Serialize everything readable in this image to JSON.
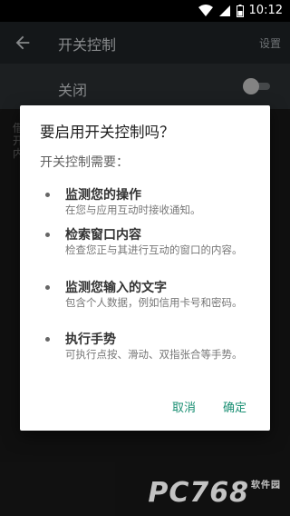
{
  "status_bar": {
    "time": "10:12"
  },
  "appbar": {
    "title": "开关控制",
    "settings_label": "设置"
  },
  "master_switch": {
    "label": "关闭",
    "state": "off"
  },
  "background": {
    "line1": "借",
    "line2": "开",
    "line3": "内"
  },
  "dialog": {
    "title": "要启用开关控制吗？",
    "subtitle": "开关控制需要：",
    "permissions": [
      {
        "title": "监测您的操作",
        "desc": "在您与应用互动时接收通知。"
      },
      {
        "title": "检索窗口内容",
        "desc": "检查您正与其进行互动的窗口的内容。"
      },
      {
        "title": "监测您输入的文字",
        "desc": "包含个人数据，例如信用卡号和密码。"
      },
      {
        "title": "执行手势",
        "desc": "可执行点按、滑动、双指张合等手势。"
      }
    ],
    "cancel_label": "取消",
    "confirm_label": "确定"
  },
  "watermark": {
    "text": "PC768",
    "suffix": "软件园"
  },
  "colors": {
    "accent": "#1a8f73",
    "appbar": "#1f2427",
    "dialog_bg": "#ffffff"
  }
}
